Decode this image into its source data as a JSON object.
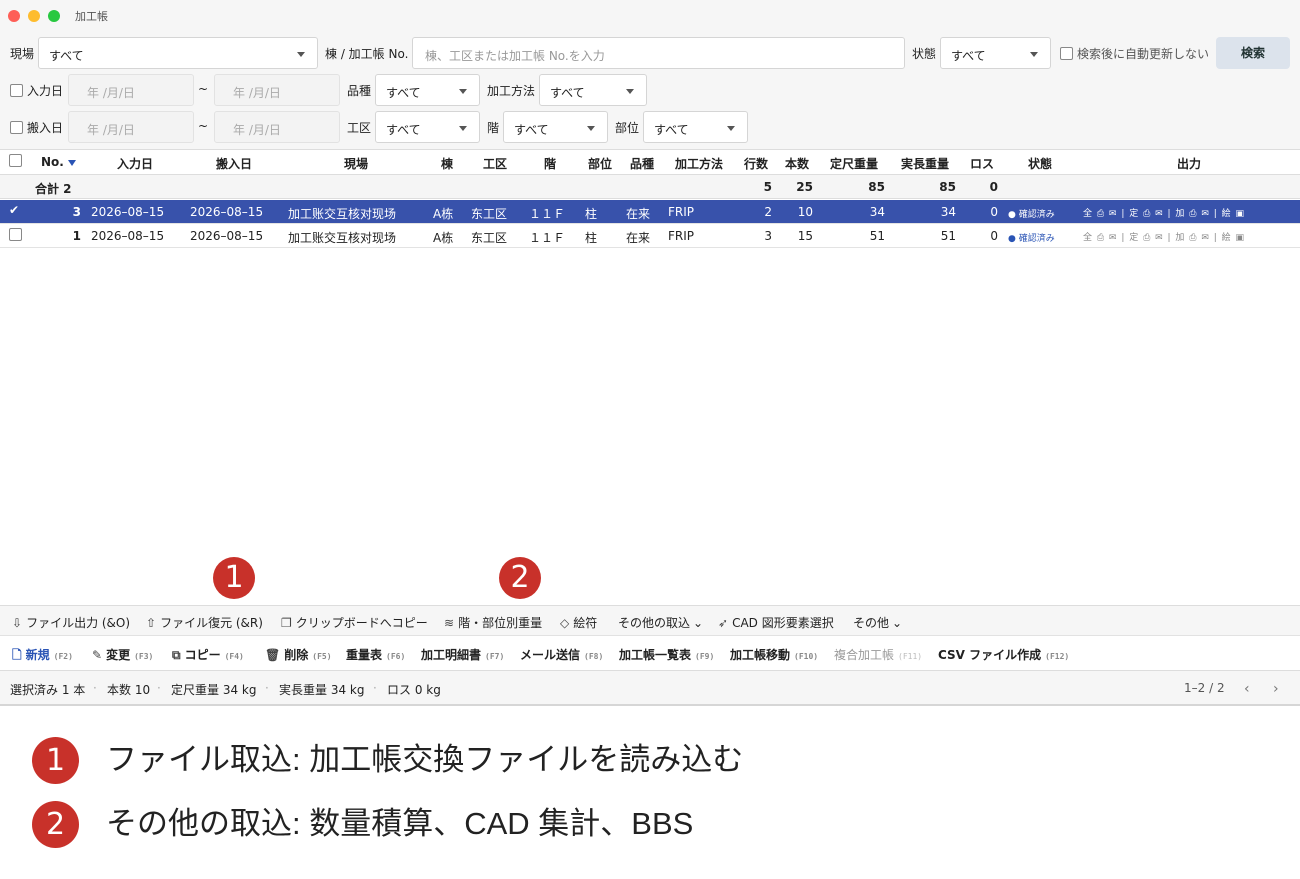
{
  "window": {
    "title": "加工帳"
  },
  "filters": {
    "site_label": "現場",
    "site_value": "すべて",
    "building_label": "棟 / 加工帳 No.",
    "building_placeholder": "棟、工区または加工帳 No.を入力",
    "state_label": "状態",
    "state_value": "すべて",
    "auto_update_label": "検索後に自動更新しない",
    "search_button": "検索",
    "entry_date_label": "入力日",
    "delivery_date_label": "搬入日",
    "date_placeholder": "年 /月/日",
    "tilde": "~",
    "item_label": "品種",
    "item_value": "すべて",
    "method_label": "加工方法",
    "method_value": "すべて",
    "zone_label": "工区",
    "zone_value": "すべて",
    "floor_label": "階",
    "floor_value": "すべて",
    "part_label": "部位",
    "part_value": "すべて"
  },
  "table": {
    "headers": {
      "no": "No.",
      "entry": "入力日",
      "delivery": "搬入日",
      "site": "現場",
      "bldg": "棟",
      "zone": "工区",
      "floor": "階",
      "part": "部位",
      "item": "品種",
      "method": "加工方法",
      "lines": "行数",
      "count": "本数",
      "std_w": "定尺重量",
      "act_w": "実長重量",
      "loss": "ロス",
      "state": "状態",
      "output": "出力"
    },
    "summary": {
      "label": "合計 2",
      "lines": "5",
      "count": "25",
      "std_w": "85",
      "act_w": "85",
      "loss": "0"
    },
    "rows": [
      {
        "no": "3",
        "entry": "2026–08–15",
        "delivery": "2026–08–15",
        "site": "加工账交互核对现场",
        "bldg": "A栋",
        "zone": "东工区",
        "floor": "１１Ｆ",
        "part": "柱",
        "item": "在来",
        "method": "FRIP",
        "lines": "2",
        "count": "10",
        "std_w": "34",
        "act_w": "34",
        "loss": "0",
        "state": "● 確認済み",
        "output": "全 ⎙ ✉ | 定 ⎙ ✉ | 加 ⎙ ✉ | 絵 ▣"
      },
      {
        "no": "1",
        "entry": "2026–08–15",
        "delivery": "2026–08–15",
        "site": "加工账交互核对现场",
        "bldg": "A栋",
        "zone": "东工区",
        "floor": "１１Ｆ",
        "part": "柱",
        "item": "在来",
        "method": "FRIP",
        "lines": "3",
        "count": "15",
        "std_w": "51",
        "act_w": "51",
        "loss": "0",
        "state": "● 確認済み",
        "output": "全 ⎙ ✉ | 定 ⎙ ✉ | 加 ⎙ ✉ | 絵 ▣"
      }
    ]
  },
  "callouts": {
    "one": "1",
    "two": "2"
  },
  "toolbar1": {
    "file_out": "ファイル出力 (&O)",
    "file_restore": "ファイル復元 (&R)",
    "clipboard": "クリップボードへコピー",
    "floor_weight": "階・部位別重量",
    "label": "絵符",
    "other_import": "その他の取込",
    "cad_select": "CAD 図形要素選択",
    "other": "その他"
  },
  "toolbar2": {
    "new": "新規",
    "new_key": "(F2)",
    "change": "変更",
    "change_key": "(F3)",
    "copy": "コピー",
    "copy_key": "(F4)",
    "delete": "削除",
    "delete_key": "(F5)",
    "weight": "重量表",
    "weight_key": "(F6)",
    "detail": "加工明細書",
    "detail_key": "(F7)",
    "mail": "メール送信",
    "mail_key": "(F8)",
    "list": "加工帳一覧表",
    "list_key": "(F9)",
    "move": "加工帳移動",
    "move_key": "(F10)",
    "compound": "複合加工帳",
    "compound_key": "(F11)",
    "csv": "CSV ファイル作成",
    "csv_key": "(F12)"
  },
  "statusbar": {
    "selected": "選択済み 1 本",
    "count": "本数 10",
    "std": "定尺重量 34 kg",
    "act": "実長重量 34 kg",
    "loss": "ロス 0 kg",
    "pages": "1–2 / 2"
  },
  "legend": {
    "one_num": "1",
    "one_text": "ファイル取込: 加工帳交換ファイルを読み込む",
    "two_num": "2",
    "two_text": "その他の取込: 数量積算、CAD 集計、BBS"
  },
  "colors": {
    "accent": "#3852ab",
    "callout": "#c8312a"
  }
}
